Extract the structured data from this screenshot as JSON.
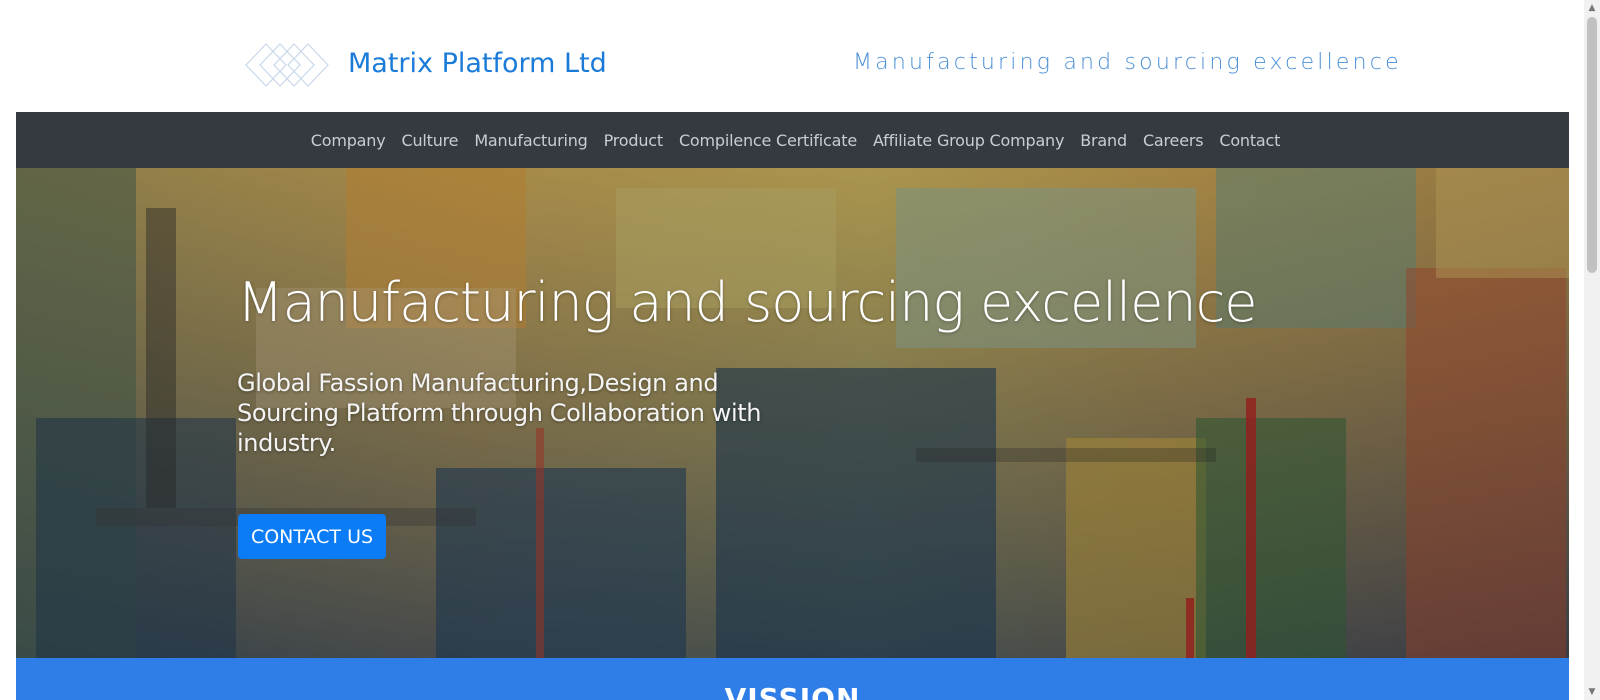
{
  "header": {
    "brand_name": "Matrix Platform Ltd",
    "tagline": "Manufacturing and sourcing excellence",
    "logo_icon": "diamond-lattice-logo-icon"
  },
  "nav": {
    "items": [
      {
        "label": "Company"
      },
      {
        "label": "Culture"
      },
      {
        "label": "Manufacturing"
      },
      {
        "label": "Product"
      },
      {
        "label": "Compilence Certificate"
      },
      {
        "label": "Affiliate Group Company"
      },
      {
        "label": "Brand"
      },
      {
        "label": "Careers"
      },
      {
        "label": "Contact"
      }
    ]
  },
  "hero": {
    "title": "Manufacturing and sourcing excellence",
    "subtitle": "Global Fassion Manufacturing,Design and Sourcing Platform through Collaboration with industry.",
    "cta_label": "CONTACT US"
  },
  "vision": {
    "title": "VISSION"
  },
  "colors": {
    "brand": "#1a7bd8",
    "nav_bg": "#343a40",
    "cta": "#0b7cf5",
    "vision_bg": "#2f7ee8"
  }
}
